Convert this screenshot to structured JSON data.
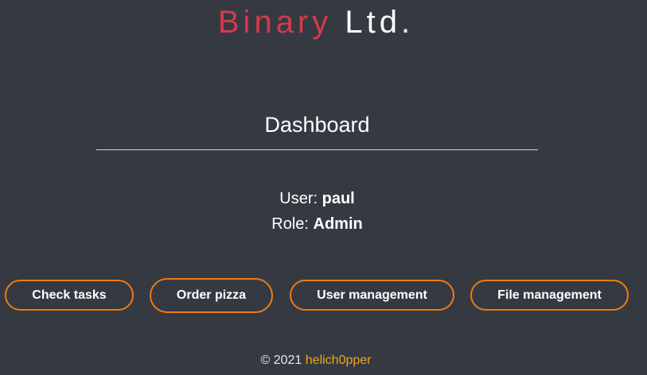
{
  "brand": {
    "part1": "Binary",
    "part2": "Ltd."
  },
  "page": {
    "title": "Dashboard"
  },
  "user": {
    "label": "User:",
    "name": "paul",
    "role_label": "Role:",
    "role": "Admin"
  },
  "actions": {
    "check_tasks": "Check tasks",
    "order_pizza": "Order pizza",
    "user_management": "User management",
    "file_management": "File management"
  },
  "footer": {
    "copyright": "© 2021",
    "author": "helich0pper"
  },
  "colors": {
    "background": "#353a42",
    "brand_red": "#d6394a",
    "button_border": "#ee7a12",
    "footer_link": "#f4a31a"
  }
}
